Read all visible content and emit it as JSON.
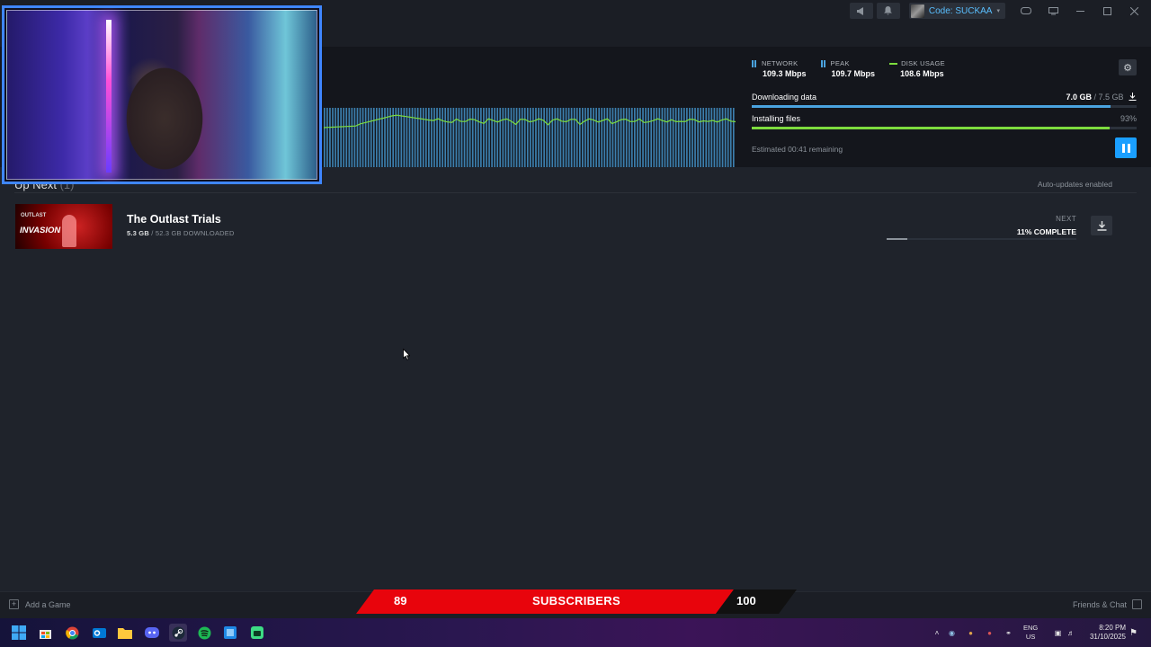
{
  "titlebar": {
    "account_name": "Code: SUCKAA",
    "icons": [
      "megaphone-icon",
      "bell-icon",
      "vr-icon",
      "monitor-icon",
      "minimize-icon",
      "maximize-icon",
      "close-icon"
    ]
  },
  "download": {
    "stats": {
      "network_label": "NETWORK",
      "network_value": "109.3 Mbps",
      "peak_label": "PEAK",
      "peak_value": "109.7 Mbps",
      "disk_label": "DISK USAGE",
      "disk_value": "108.6 Mbps"
    },
    "downloading_label": "Downloading data",
    "downloaded": "7.0 GB",
    "downloaded_sep": " / ",
    "download_total": "7.5 GB",
    "download_fraction": 0.933,
    "installing_label": "Installing files",
    "installing_pct": "93%",
    "installing_fraction": 0.93,
    "eta": "Estimated 00:41 remaining"
  },
  "upnext": {
    "title": "Up Next",
    "count": "(1)",
    "auto_updates": "Auto-updates enabled",
    "item": {
      "name": "The Outlast Trials",
      "thumb_small": "OUTLAST",
      "thumb_big": "INVASION",
      "size_done": "5.3 GB",
      "size_rest": " / 52.3 GB DOWNLOADED",
      "next_label": "NEXT",
      "complete_label": "11% COMPLETE",
      "progress_fraction": 0.11
    }
  },
  "footer": {
    "add_game": "Add a Game",
    "friends_chat": "Friends & Chat"
  },
  "subs_overlay": {
    "start": "89",
    "label": "SUBSCRIBERS",
    "goal": "100"
  },
  "taskbar": {
    "apps": [
      "windows-start-icon",
      "microsoft-store-icon",
      "chrome-icon",
      "outlook-icon",
      "file-explorer-icon",
      "discord-icon",
      "steam-icon",
      "spotify-icon",
      "app-icon",
      "android-icon"
    ],
    "lang_top": "ENG",
    "lang_bottom": "US",
    "time": "8:20 PM",
    "date": "31/10/2025"
  },
  "colors": {
    "accent": "#1a9fff",
    "network_series": "#4aa3df",
    "disk_series": "#7ddc3e",
    "subs_red": "#e8040c"
  }
}
